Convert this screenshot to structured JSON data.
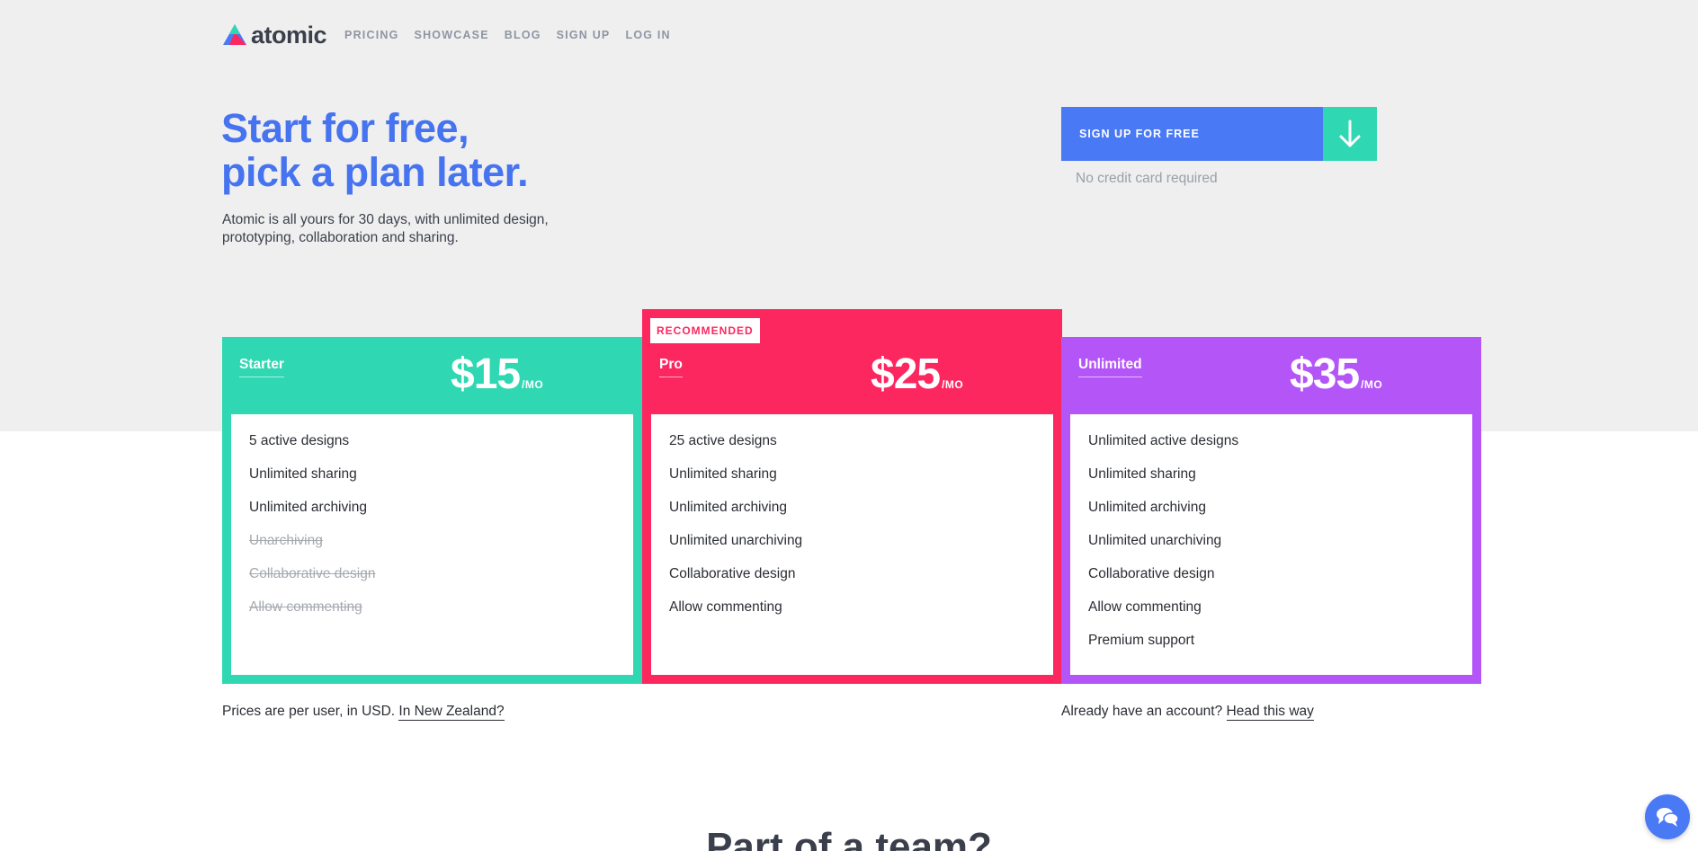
{
  "brand": {
    "name": "atomic"
  },
  "nav": {
    "items": [
      {
        "label": "PRICING"
      },
      {
        "label": "SHOWCASE"
      },
      {
        "label": "BLOG"
      },
      {
        "label": "SIGN UP"
      },
      {
        "label": "LOG IN"
      }
    ]
  },
  "hero": {
    "title_line1": "Start for free,",
    "title_line2": "pick a plan later.",
    "description": "Atomic is all yours for 30 days, with unlimited design, prototyping, collaboration and sharing.",
    "cta_label": "SIGN UP FOR FREE",
    "cta_note": "No credit card required"
  },
  "plans": {
    "starter": {
      "name": "Starter",
      "price": "$15",
      "period": "/MO",
      "color": "#2fd8b2",
      "features": [
        {
          "label": "5 active designs",
          "included": true
        },
        {
          "label": "Unlimited sharing",
          "included": true
        },
        {
          "label": "Unlimited archiving",
          "included": true
        },
        {
          "label": "Unarchiving",
          "included": false
        },
        {
          "label": "Collaborative design",
          "included": false
        },
        {
          "label": "Allow commenting",
          "included": false
        }
      ]
    },
    "pro": {
      "name": "Pro",
      "badge": "RECOMMENDED",
      "price": "$25",
      "period": "/MO",
      "color": "#fd2760",
      "features": [
        {
          "label": "25 active designs",
          "included": true
        },
        {
          "label": "Unlimited sharing",
          "included": true
        },
        {
          "label": "Unlimited archiving",
          "included": true
        },
        {
          "label": "Unlimited unarchiving",
          "included": true
        },
        {
          "label": "Collaborative design",
          "included": true
        },
        {
          "label": "Allow commenting",
          "included": true
        }
      ]
    },
    "unlimited": {
      "name": "Unlimited",
      "price": "$35",
      "period": "/MO",
      "color": "#b455f8",
      "features": [
        {
          "label": "Unlimited active designs",
          "included": true
        },
        {
          "label": "Unlimited sharing",
          "included": true
        },
        {
          "label": "Unlimited archiving",
          "included": true
        },
        {
          "label": "Unlimited unarchiving",
          "included": true
        },
        {
          "label": "Collaborative design",
          "included": true
        },
        {
          "label": "Allow commenting",
          "included": true
        },
        {
          "label": "Premium support",
          "included": true
        }
      ]
    }
  },
  "footnotes": {
    "prices_text": "Prices are per user, in USD. ",
    "prices_link": "In New Zealand?",
    "account_text": "Already have an account? ",
    "account_link": "Head this way"
  },
  "team": {
    "title": "Part of a team?"
  },
  "icons": {
    "logo": "atomic-logo-icon",
    "cta_arrow": "arrow-down-icon",
    "chat": "chat-bubbles-icon"
  }
}
